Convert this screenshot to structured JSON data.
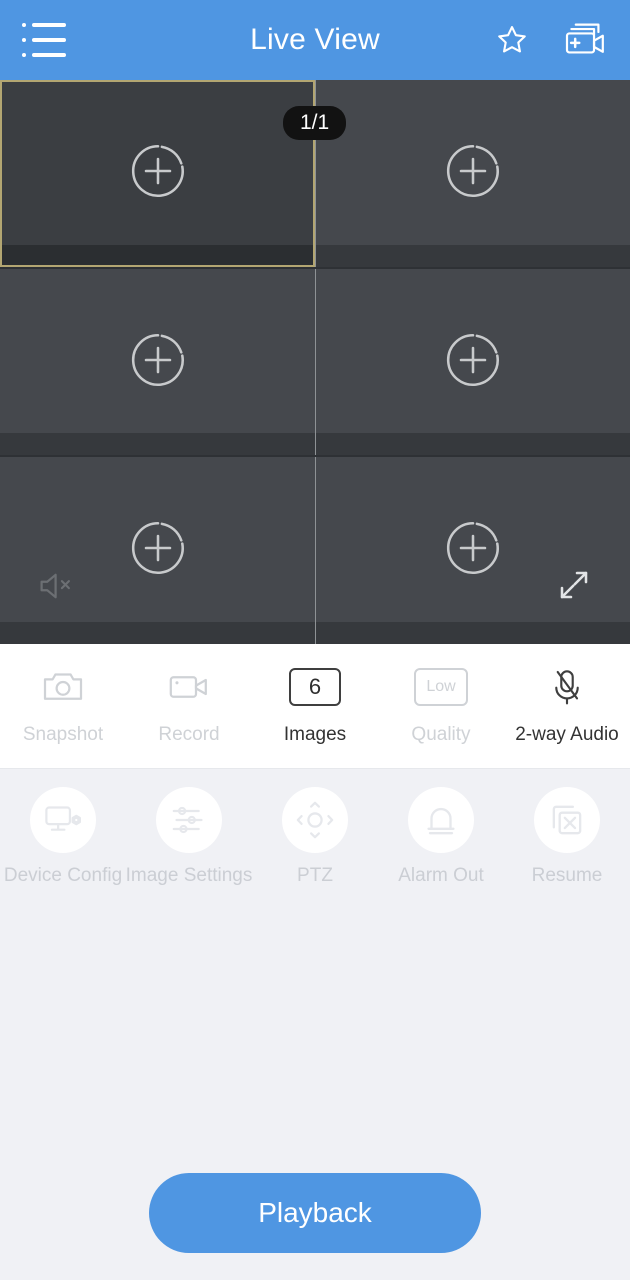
{
  "header": {
    "title": "Live View",
    "menu_icon": "list-menu-icon",
    "favorite_icon": "star-icon",
    "add_device_icon": "add-camera-icon",
    "background_color": "#4f96e2"
  },
  "video_grid": {
    "page_badge": "1/1",
    "selected_border_color": "#b3a672",
    "cell_background": "#45484d",
    "cells": [
      {
        "id": "cell-1",
        "placeholder_icon": "add-channel-icon",
        "selected": true
      },
      {
        "id": "cell-2",
        "placeholder_icon": "add-channel-icon",
        "selected": false
      },
      {
        "id": "cell-3",
        "placeholder_icon": "add-channel-icon",
        "selected": false
      },
      {
        "id": "cell-4",
        "placeholder_icon": "add-channel-icon",
        "selected": false
      },
      {
        "id": "cell-5",
        "placeholder_icon": "add-channel-icon",
        "selected": false
      },
      {
        "id": "cell-6",
        "placeholder_icon": "add-channel-icon",
        "selected": false
      }
    ],
    "mute_icon": "speaker-muted-icon",
    "expand_icon": "fullscreen-expand-icon"
  },
  "toolbar_primary": [
    {
      "label": "Snapshot",
      "icon": "camera-icon",
      "enabled": false,
      "value": ""
    },
    {
      "label": "Record",
      "icon": "video-camera-icon",
      "enabled": false,
      "value": ""
    },
    {
      "label": "Images",
      "icon": "boxed-value",
      "enabled": true,
      "value": "6"
    },
    {
      "label": "Quality",
      "icon": "boxed-value",
      "enabled": false,
      "value": "Low"
    },
    {
      "label": "2-way Audio",
      "icon": "microphone-muted-icon",
      "enabled": true,
      "value": ""
    }
  ],
  "toolbar_secondary": [
    {
      "label": "Device Config",
      "icon": "monitor-gear-icon",
      "enabled": false
    },
    {
      "label": "Image Settings",
      "icon": "sliders-icon",
      "enabled": false
    },
    {
      "label": "PTZ",
      "icon": "ptz-dpad-icon",
      "enabled": false
    },
    {
      "label": "Alarm Out",
      "icon": "alarm-siren-icon",
      "enabled": false
    },
    {
      "label": "Resume",
      "icon": "stacked-pages-x-icon",
      "enabled": false
    }
  ],
  "footer": {
    "playback_label": "Playback",
    "playback_color": "#4f96e2"
  }
}
